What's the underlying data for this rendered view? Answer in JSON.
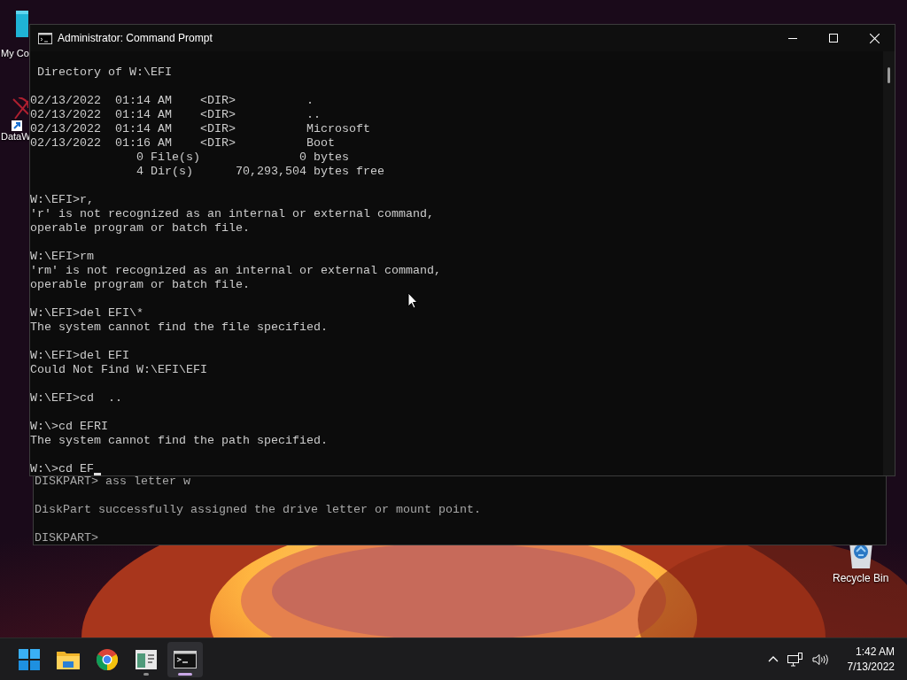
{
  "desktop_icons": [
    {
      "kind": "computer",
      "label": "My Co"
    },
    {
      "kind": "shortcut",
      "label": "DataW"
    },
    {
      "kind": "recycle-bin",
      "label": "Recycle Bin"
    }
  ],
  "background_window": {
    "blocks": [
      [
        "DISKPART> ass letter w"
      ],
      [
        "DiskPart successfully assigned the drive letter or mount point."
      ],
      [
        "DISKPART>"
      ]
    ]
  },
  "window": {
    "title": "Administrator: Command Prompt",
    "blocks": [
      [
        " Directory of W:\\EFI"
      ],
      [
        "02/13/2022  01:14 AM    <DIR>          .",
        "02/13/2022  01:14 AM    <DIR>          ..",
        "02/13/2022  01:14 AM    <DIR>          Microsoft",
        "02/13/2022  01:16 AM    <DIR>          Boot",
        "               0 File(s)              0 bytes",
        "               4 Dir(s)      70,293,504 bytes free"
      ],
      [
        "W:\\EFI>r,",
        "'r' is not recognized as an internal or external command,",
        "operable program or batch file."
      ],
      [
        "W:\\EFI>rm",
        "'rm' is not recognized as an internal or external command,",
        "operable program or batch file."
      ],
      [
        "W:\\EFI>del EFI\\*",
        "The system cannot find the file specified."
      ],
      [
        "W:\\EFI>del EFI",
        "Could Not Find W:\\EFI\\EFI"
      ],
      [
        "W:\\EFI>cd  .."
      ],
      [
        "W:\\>cd EFRI",
        "The system cannot find the path specified."
      ],
      [
        "W:\\>cd EF"
      ]
    ]
  },
  "taskbar": {
    "apps": [
      {
        "kind": "start",
        "running": false,
        "selected": false
      },
      {
        "kind": "folder",
        "running": false,
        "selected": false
      },
      {
        "kind": "browser",
        "running": false,
        "selected": false
      },
      {
        "kind": "document",
        "running": true,
        "selected": false
      },
      {
        "kind": "terminal",
        "running": true,
        "selected": true
      }
    ],
    "clock": {
      "time": "1:42 AM",
      "date": "7/13/2022"
    }
  }
}
